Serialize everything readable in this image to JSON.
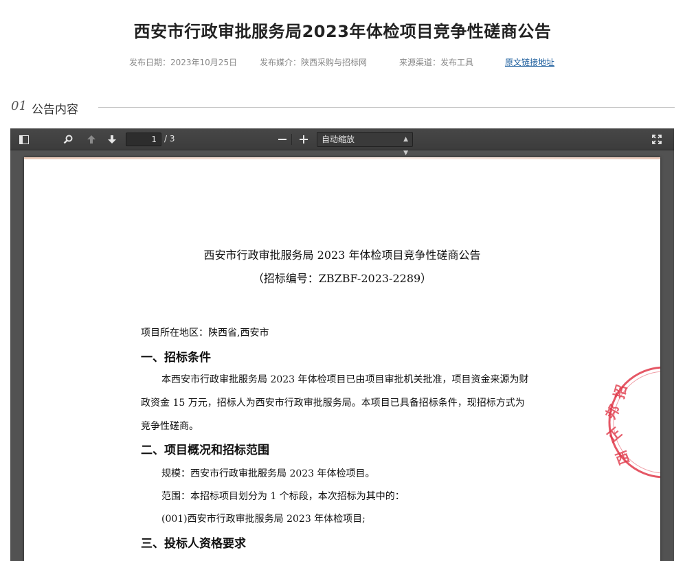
{
  "header": {
    "title": "西安市行政审批服务局2023年体检项目竞争性磋商公告",
    "publish_date": "发布日期：2023年10月25日",
    "publish_media": "发布媒介：陕西采购与招标网",
    "source": "来源渠道：发布工具",
    "original_link": "原文链接地址"
  },
  "section": {
    "number": "01",
    "label": "公告内容"
  },
  "viewer": {
    "current_page": "1",
    "total_pages": "/ 3",
    "zoom_label": "自动缩放",
    "icons": {
      "sidebar": "sidebar-toggle-icon",
      "find": "search-icon",
      "prev": "arrow-up-icon",
      "next": "arrow-down-icon",
      "zoom_out": "minus-icon",
      "zoom_in": "plus-icon",
      "fullscreen": "fullscreen-icon"
    }
  },
  "document": {
    "title": "西安市行政审批服务局 2023 年体检项目竞争性磋商公告",
    "subtitle": "（招标编号：ZBZBF-2023-2289）",
    "location": "项目所在地区：陕西省,西安市",
    "h1": "一、招标条件",
    "p1_line1": "本西安市行政审批服务局 2023 年体检项目已由项目审批机关批准，项目资金来源为财",
    "p1_line2": "政资金 15 万元，招标人为西安市行政审批服务局。本项目已具备招标条件，现招标方式为",
    "p1_line3": "竞争性磋商。",
    "h2": "二、项目概况和招标范围",
    "scale": "规模：西安市行政审批服务局 2023 年体检项目。",
    "scope": "范围：本招标项目划分为 1 个标段，本次招标为其中的：",
    "lot": "(001)西安市行政审批服务局 2023 年体检项目;",
    "h3": "三、投标人资格要求"
  },
  "colors": {
    "link": "#1a5c9c",
    "toolbar": "#474747",
    "viewer_bg": "#525252",
    "seal_red": "#e03a4a"
  }
}
